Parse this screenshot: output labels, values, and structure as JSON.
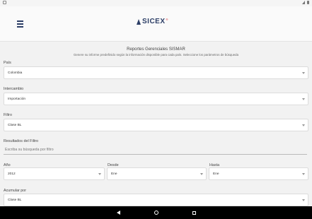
{
  "header": {
    "logo_text": "SICEX",
    "logo_superscript": "®"
  },
  "page": {
    "title": "Reportes Gerenciales SISMAR",
    "subtitle": "Genere su informe predefinido según la información disponible para cada país. Seleccione los parámetros de búsqueda"
  },
  "form": {
    "pais": {
      "label": "País",
      "value": "Colombia"
    },
    "intercambio": {
      "label": "Intercambio",
      "value": "Importación"
    },
    "filtro": {
      "label": "Filtro",
      "value": "Clase BL"
    },
    "resultados": {
      "label": "Resultados del Filtro",
      "placeholder": "Escriba su búsqueda por filtro"
    },
    "anio": {
      "label": "Año",
      "value": "2012"
    },
    "desde": {
      "label": "Desde",
      "value": "Ene"
    },
    "hasta": {
      "label": "Hasta",
      "value": "Ene"
    },
    "acumular": {
      "label": "Acumular por",
      "value": "Clase BL"
    }
  },
  "icons": {
    "menu": "hamburger-icon",
    "back": "back-icon",
    "home": "home-icon",
    "recent": "recent-apps-icon"
  }
}
